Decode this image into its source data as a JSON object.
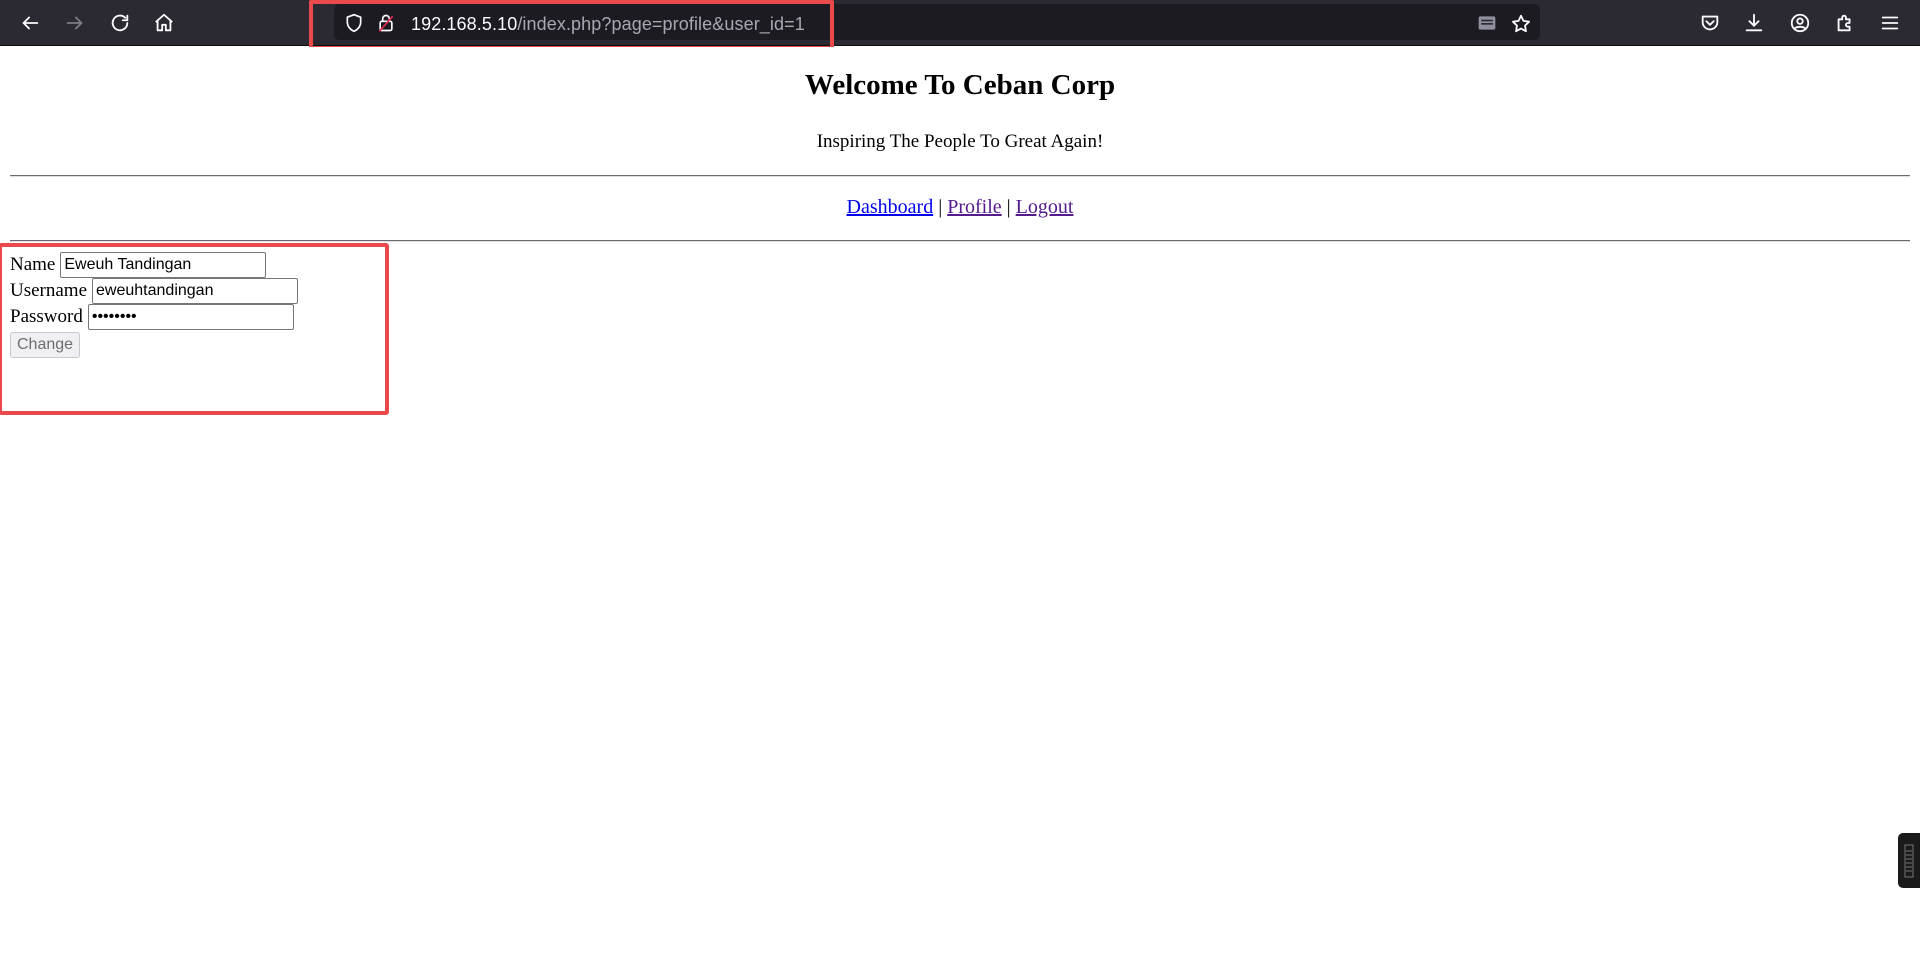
{
  "browser": {
    "url_host": "192.168.5.10",
    "url_path": "/index.php?page=profile&user_id=1"
  },
  "site": {
    "title": "Welcome To Ceban Corp",
    "tagline": "Inspiring The People To Great Again!"
  },
  "nav": {
    "dashboard": "Dashboard",
    "separator": "|",
    "profile": "Profile",
    "logout": "Logout"
  },
  "form": {
    "name_label": "Name",
    "name_value": "Eweuh Tandingan",
    "username_label": "Username",
    "username_value": "eweuhtandingan",
    "password_label": "Password",
    "password_value": "password",
    "submit_label": "Change"
  },
  "colors": {
    "toolbar_bg": "#2b2a33",
    "urlbar_bg": "#1c1b22",
    "highlight": "#ea4a4c",
    "link": "#0000ee",
    "visited_link": "#551a8b"
  },
  "icons": {
    "toolbar_left": [
      "back-arrow-icon",
      "forward-arrow-icon",
      "reload-icon",
      "home-icon"
    ],
    "urlbar": [
      "tracking-shield-icon",
      "insecure-lock-icon",
      "reader-mode-icon",
      "bookmark-star-icon"
    ],
    "toolbar_right": [
      "pocket-icon",
      "download-icon",
      "account-icon",
      "extensions-icon",
      "menu-icon"
    ]
  }
}
